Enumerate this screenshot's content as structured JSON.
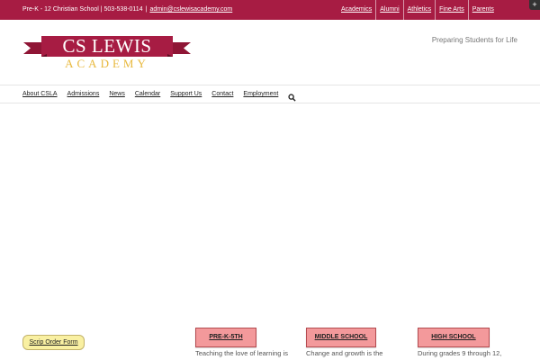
{
  "topbar": {
    "contact_text": "Pre-K - 12 Christian School | 503-538-0114",
    "separator": "|",
    "email": "admin@cslewisacademy.com",
    "links": [
      "Academics",
      "Alumni",
      "Athletics",
      "Fine Arts",
      "Parents"
    ],
    "plus_label": "+"
  },
  "header": {
    "logo_top": "CS LEWIS",
    "logo_bottom": "ACADEMY",
    "tagline": "Preparing Students for Life"
  },
  "nav": {
    "items": [
      "About CSLA",
      "Admissions",
      "News",
      "Calendar",
      "Support Us",
      "Contact",
      "Employment"
    ],
    "search_icon": "search-icon"
  },
  "content": {
    "scrip_button": "Scrip Order Form",
    "partial_text": "",
    "schools": [
      {
        "button": "PRE-K-5TH",
        "desc": "Teaching the love of learning is"
      },
      {
        "button": "MIDDLE SCHOOL",
        "desc": "Change and growth is the"
      },
      {
        "button": "HIGH SCHOOL",
        "desc": "During grades 9 through 12,"
      }
    ]
  },
  "colors": {
    "brand": "#a71c43",
    "logo_gold": "#e8b83c",
    "school_button": "#f3999b",
    "scrip_button": "#f9f0a2"
  }
}
